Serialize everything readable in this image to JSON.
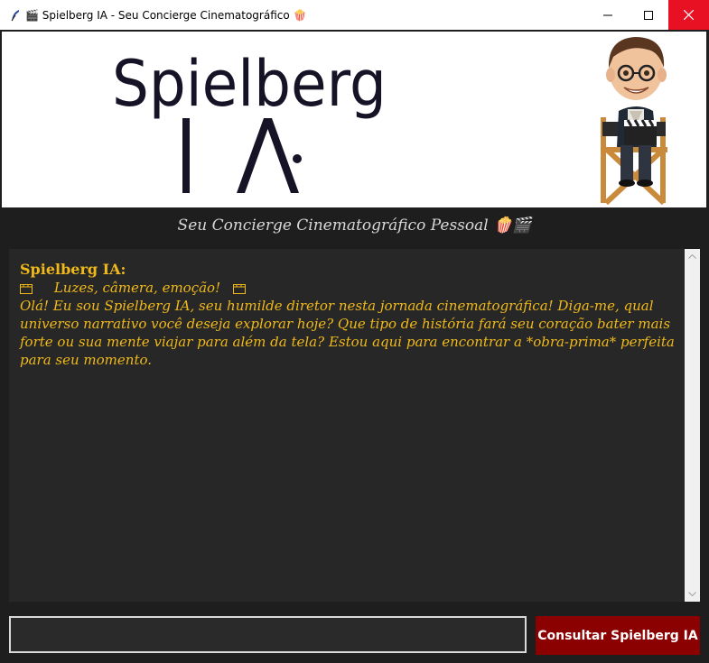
{
  "window": {
    "title": "🎬 Spielberg IA - Seu Concierge Cinematográfico 🍿"
  },
  "banner": {
    "logo_word": "Spielberg",
    "logo_sub": "IA"
  },
  "subtitle": "Seu Concierge Cinematográfico Pessoal 🍿🎬",
  "chat": {
    "sender": "Spielberg IA:",
    "tagline": "Luzes, câmera, emoção!",
    "body": "Olá! Eu sou Spielberg IA, seu humilde diretor nesta jornada cinematográfica! Diga-me, qual universo narrativo você deseja explorar hoje? Que tipo de história fará seu coração bater mais forte ou sua mente viajar para além da tela? Estou aqui para encontrar a *obra-prima* perfeita para seu momento."
  },
  "input": {
    "value": "",
    "placeholder": ""
  },
  "send_button": {
    "label": "Consultar Spielberg IA"
  },
  "colors": {
    "background": "#1e1e1e",
    "chat_bg": "#272727",
    "chat_text": "#f0b91a",
    "button_bg": "#8b0000"
  }
}
